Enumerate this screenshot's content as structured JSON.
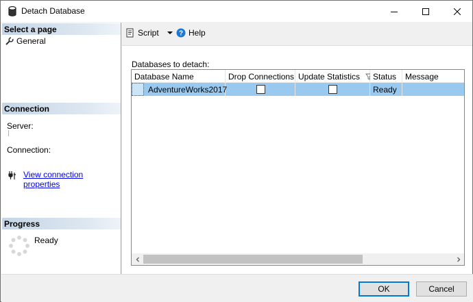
{
  "window": {
    "title": "Detach Database",
    "minimize_icon": "minimize-icon",
    "maximize_icon": "maximize-icon",
    "close_icon": "close-icon"
  },
  "left": {
    "select_page_header": "Select a page",
    "pages": [
      {
        "label": "General",
        "icon": "wrench-icon"
      }
    ],
    "connection_header": "Connection",
    "server_label": "Server:",
    "connection_label": "Connection:",
    "view_connection_link": "View connection properties",
    "progress_header": "Progress",
    "progress_status": "Ready"
  },
  "toolbar": {
    "script_label": "Script",
    "help_label": "Help"
  },
  "grid": {
    "label": "Databases to detach:",
    "columns": [
      "Database Name",
      "Drop Connections",
      "Update Statistics",
      "Status",
      "Message"
    ],
    "rows": [
      {
        "database_name": "AdventureWorks2017",
        "drop_connections": false,
        "update_statistics": false,
        "status": "Ready",
        "message": ""
      }
    ]
  },
  "buttons": {
    "ok": "OK",
    "cancel": "Cancel"
  },
  "colors": {
    "selected_row": "#99c9ef",
    "link": "#0000ee",
    "ok_border": "#0078d7",
    "help_icon": "#1e78d2"
  }
}
